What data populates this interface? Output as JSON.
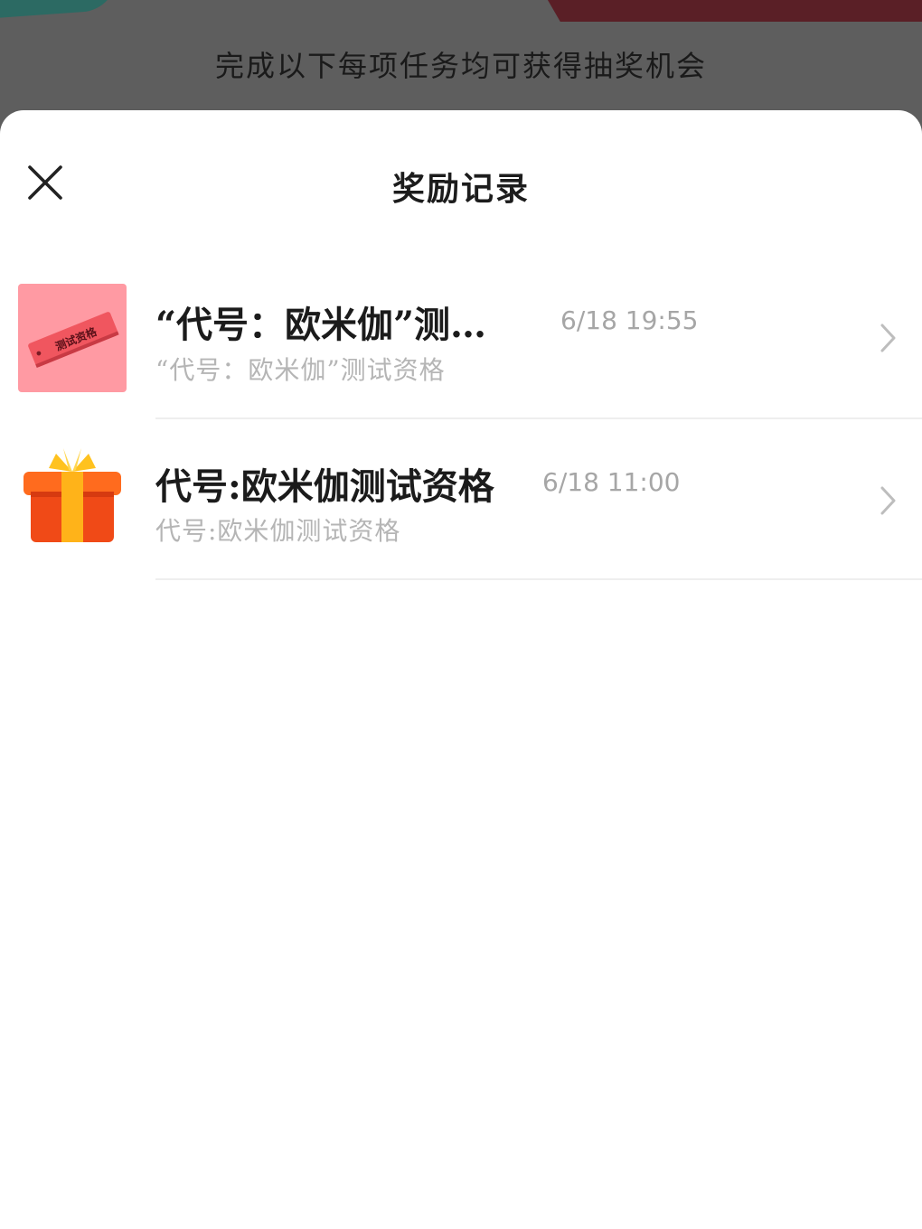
{
  "backdrop": {
    "task_hint": "完成以下每项任务均可获得抽奖机会"
  },
  "sheet": {
    "title": "奖励记录",
    "close_icon": "close-icon"
  },
  "records": [
    {
      "title": "“代号：欧米伽”测…",
      "time": "6/18 19:55",
      "subtitle": "“代号：欧米伽”测试资格",
      "icon": "ticket-icon",
      "ticket_label": "测试资格"
    },
    {
      "title": "代号:欧米伽测试资格",
      "time": "6/18 11:00",
      "subtitle": "代号:欧米伽测试资格",
      "icon": "gift-box-icon"
    }
  ],
  "colors": {
    "ticket_bg": "#ff9aa3",
    "ticket": "#f0565f",
    "gift_box": "#f04a17",
    "gift_ribbon": "#ffb319",
    "chevron": "#bdbdbd"
  }
}
